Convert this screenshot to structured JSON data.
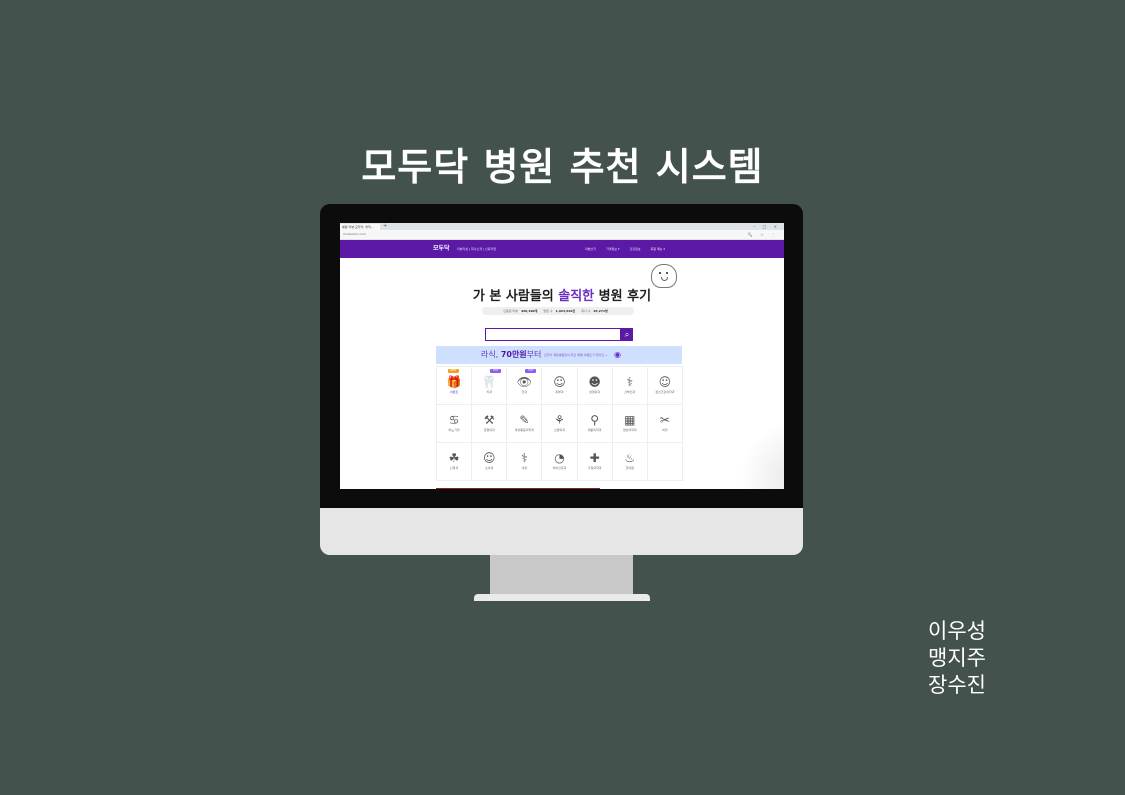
{
  "title": "모두닥 병원 추천 시스템",
  "authors": [
    "이우성",
    "맹지주",
    "장수진"
  ],
  "browser": {
    "tab_title": "병원 리뷰 모두닥: 솔직...",
    "new_tab": "+",
    "window_controls": "– □ ×",
    "url": "modoodoc.com",
    "address_icons": "🔍 ☆ ⋮"
  },
  "site": {
    "logo": "모두닥",
    "nav_left": "리뷰작성 | 회사소개 | 신뢰작업",
    "nav_right": [
      "리뷰쓰기",
      "가격정보 ▾",
      "건강정보",
      "회원 메뉴 ▾"
    ],
    "hero": {
      "prefix": "가 본 사람들의 ",
      "highlight": "솔직한",
      "suffix": " 병원 후기"
    },
    "stats": [
      {
        "label": "인증된 리뷰",
        "value": "420,390개"
      },
      {
        "label": "방문 수",
        "value": "1,923,640건"
      },
      {
        "label": "회사 수",
        "value": "93,271명"
      }
    ],
    "search": {
      "placeholder": "",
      "button_icon": "search-icon"
    },
    "banner": {
      "main_prefix": "라식, ",
      "main_bold": "70만원",
      "main_suffix": "부터",
      "sub": "모두닥 제휴병원만의 최신 특별 이벤트가 있어요 →"
    },
    "categories": [
      {
        "label": "이벤트",
        "icon": "🎁",
        "badge": "BEST",
        "selected": true
      },
      {
        "label": "치과",
        "icon": "🦷",
        "badge": "HOT",
        "selected": false
      },
      {
        "label": "안과",
        "icon": "👁",
        "badge": "HOT",
        "selected": false
      },
      {
        "label": "피부과",
        "icon": "☺",
        "badge": "",
        "selected": false
      },
      {
        "label": "성형외과",
        "icon": "☻",
        "badge": "",
        "selected": false
      },
      {
        "label": "산부인과",
        "icon": "⚕",
        "badge": "",
        "selected": false
      },
      {
        "label": "정신건강의학과",
        "icon": "☺",
        "badge": "",
        "selected": false
      },
      {
        "label": "비뇨기과",
        "icon": "♋",
        "badge": "",
        "selected": false
      },
      {
        "label": "정형외과",
        "icon": "⚒",
        "badge": "",
        "selected": false
      },
      {
        "label": "마취통증의학과",
        "icon": "✎",
        "badge": "",
        "selected": false
      },
      {
        "label": "신경외과",
        "icon": "⚘",
        "badge": "",
        "selected": false
      },
      {
        "label": "재활의학과",
        "icon": "⚲",
        "badge": "",
        "selected": false
      },
      {
        "label": "영상의학과",
        "icon": "▦",
        "badge": "",
        "selected": false
      },
      {
        "label": "외과",
        "icon": "✂",
        "badge": "",
        "selected": false
      },
      {
        "label": "신경과",
        "icon": "☘",
        "badge": "",
        "selected": false
      },
      {
        "label": "소아과",
        "icon": "☺",
        "badge": "",
        "selected": false
      },
      {
        "label": "내과",
        "icon": "⚕",
        "badge": "",
        "selected": false
      },
      {
        "label": "이비인후과",
        "icon": "◔",
        "badge": "",
        "selected": false
      },
      {
        "label": "가정의학과",
        "icon": "✚",
        "badge": "",
        "selected": false
      },
      {
        "label": "한의원",
        "icon": "♨",
        "badge": "",
        "selected": false
      }
    ]
  },
  "colors": {
    "background": "#43524d",
    "brand": "#5b19a6",
    "accent": "#6a2fc3",
    "banner": "#cfe0ff"
  }
}
